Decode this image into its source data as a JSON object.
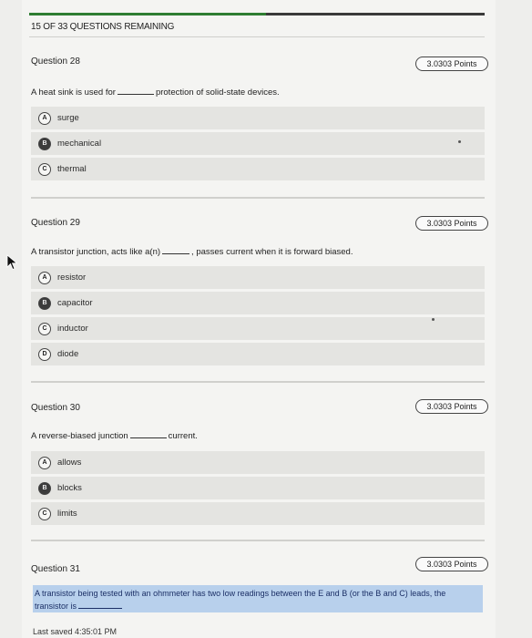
{
  "header": {
    "remaining": "15 OF 33 QUESTIONS REMAINING"
  },
  "questions": [
    {
      "title": "Question 28",
      "points": "3.0303 Points",
      "stem_before": "A heat sink is used for",
      "stem_after": "protection of solid-state devices.",
      "choices": [
        {
          "letter": "A",
          "label": "surge"
        },
        {
          "letter": "B",
          "label": "mechanical"
        },
        {
          "letter": "C",
          "label": "thermal"
        }
      ]
    },
    {
      "title": "Question 29",
      "points": "3.0303 Points",
      "stem_before": "A transistor junction, acts like a(n)",
      "stem_after": ", passes current when it is forward biased.",
      "choices": [
        {
          "letter": "A",
          "label": "resistor"
        },
        {
          "letter": "B",
          "label": "capacitor"
        },
        {
          "letter": "C",
          "label": "inductor"
        },
        {
          "letter": "D",
          "label": "diode"
        }
      ]
    },
    {
      "title": "Question 30",
      "points": "3.0303 Points",
      "stem_before": "A reverse-biased junction",
      "stem_after": "current.",
      "choices": [
        {
          "letter": "A",
          "label": "allows"
        },
        {
          "letter": "B",
          "label": "blocks"
        },
        {
          "letter": "C",
          "label": "limits"
        }
      ]
    },
    {
      "title": "Question 31",
      "points": "3.0303 Points",
      "stem_highlight": "A transistor being tested with an ohmmeter has two low readings between the E and B (or the B and C) leads, the transistor is"
    }
  ],
  "footer": {
    "last_saved": "Last saved 4:35:01 PM"
  }
}
